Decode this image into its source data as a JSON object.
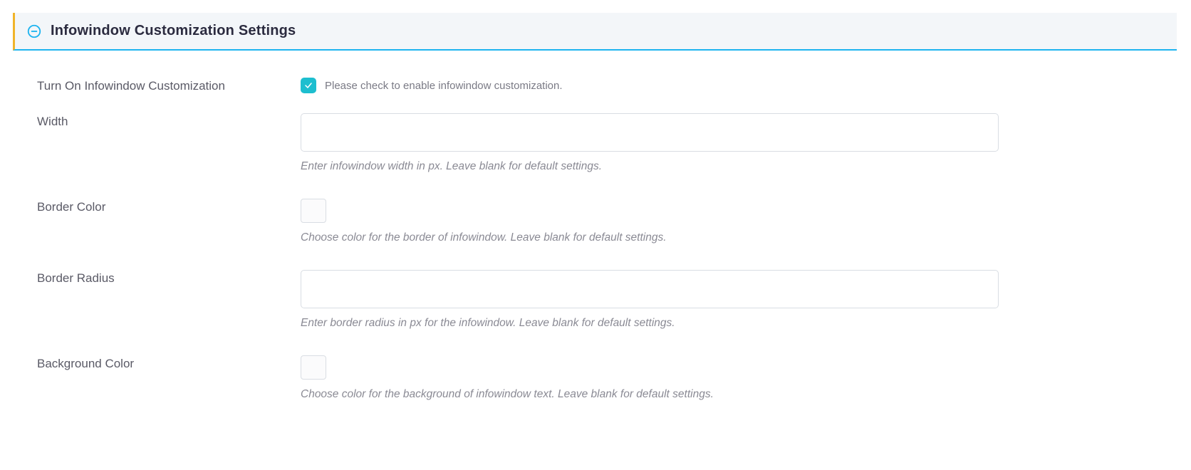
{
  "panel": {
    "title": "Infowindow Customization Settings"
  },
  "fields": {
    "enable": {
      "label": "Turn On Infowindow Customization",
      "hint": "Please check to enable infowindow customization.",
      "checked": true
    },
    "width": {
      "label": "Width",
      "value": "",
      "hint": "Enter infowindow width in px. Leave blank for default settings."
    },
    "border_color": {
      "label": "Border Color",
      "value": "",
      "hint": "Choose color for the border of infowindow. Leave blank for default settings."
    },
    "border_radius": {
      "label": "Border Radius",
      "value": "",
      "hint": "Enter border radius in px for the infowindow. Leave blank for default settings."
    },
    "background_color": {
      "label": "Background Color",
      "value": "",
      "hint": "Choose color for the background of infowindow text. Leave blank for default settings."
    }
  }
}
